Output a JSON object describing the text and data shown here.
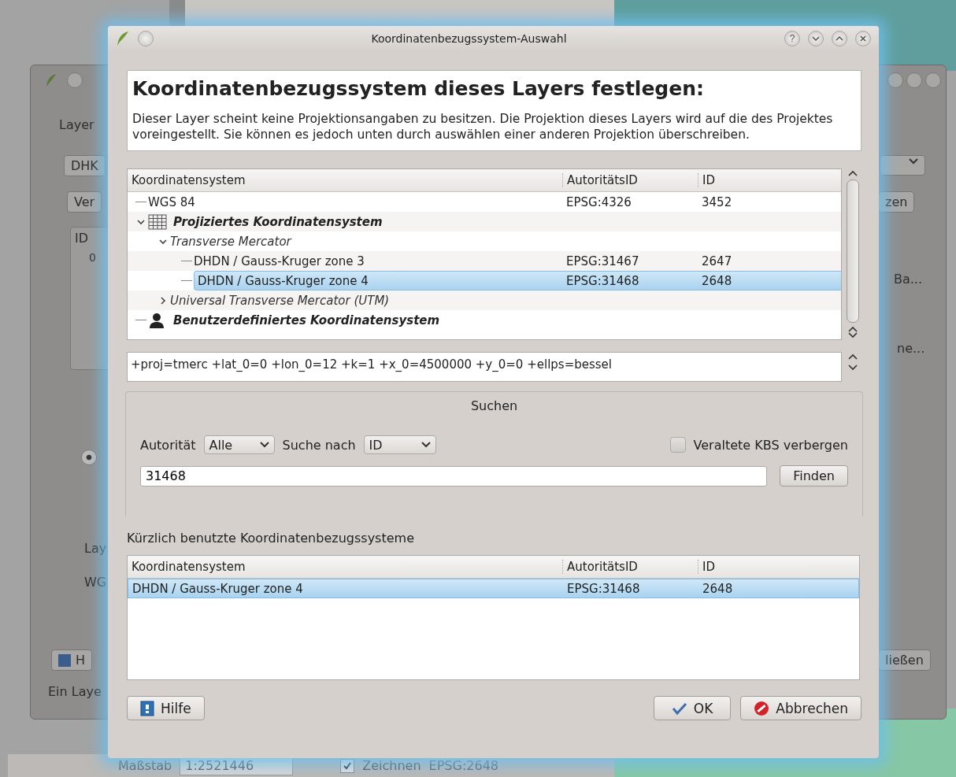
{
  "background_window": {
    "tab": "Layer",
    "combo": "DHK",
    "button": "Ver",
    "list_header": "ID",
    "list_row": "0",
    "radio_checked": true,
    "label_1": "Lay",
    "label_2": "WG",
    "help_button": "H",
    "status": "Ein Laye",
    "right_button": "zen",
    "right_item_1": "Ba...",
    "right_item_2": "ne...",
    "close_button": "ließen"
  },
  "status_bar": {
    "scale_label": "Maßstab",
    "scale": "1:2521446",
    "render_checked": true,
    "render_label": "Zeichnen",
    "crs": "EPSG:2648"
  },
  "dialog": {
    "title": "Koordinatenbezugssystem-Auswahl",
    "help_button": "?",
    "heading": "Koordinatenbezugssystem dieses Layers festlegen:",
    "description": "Dieser Layer scheint keine Projektionsangaben zu besitzen. Die Projektion dieses Layers wird auf die des Projektes voreingestellt. Sie können es jedoch unten durch auswählen einer anderen Projektion überschreiben.",
    "tree": {
      "columns": [
        "Koordinatensystem",
        "AutoritätsID",
        "ID"
      ],
      "rows": [
        {
          "kind": "crs",
          "name": "WGS 84",
          "authority_id": "EPSG:4326",
          "id": "3452",
          "selected": false
        },
        {
          "kind": "projected-category",
          "name": "Projiziertes Koordinatensystem",
          "expanded": true,
          "selected": false,
          "children": [
            {
              "kind": "subcategory",
              "name": "Transverse Mercator",
              "expanded": true,
              "selected": false,
              "children": [
                {
                  "kind": "crs",
                  "name": "DHDN / Gauss-Kruger zone 3",
                  "authority_id": "EPSG:31467",
                  "id": "2647",
                  "selected": false
                },
                {
                  "kind": "crs",
                  "name": "DHDN / Gauss-Kruger zone 4",
                  "authority_id": "EPSG:31468",
                  "id": "2648",
                  "selected": true
                }
              ]
            },
            {
              "kind": "subcategory",
              "name": "Universal Transverse Mercator (UTM)",
              "expanded": false,
              "selected": false
            }
          ]
        },
        {
          "kind": "custom-category",
          "name": "Benutzerdefiniertes Koordinatensystem",
          "selected": false
        }
      ]
    },
    "proj_string": "+proj=tmerc +lat_0=0 +lon_0=12 +k=1 +x_0=4500000 +y_0=0 +ellps=bessel",
    "search": {
      "title": "Suchen",
      "authority_label": "Autorität",
      "authority_value": "Alle",
      "search_by_label": "Suche nach",
      "search_by_value": "ID",
      "hide_deprecated": {
        "label": "Veraltete KBS verbergen",
        "checked": false
      },
      "query": "31468",
      "find_button": "Finden"
    },
    "recent": {
      "label": "Kürzlich benutzte Koordinatenbezugssysteme",
      "columns": [
        "Koordinatensystem",
        "AutoritätsID",
        "ID"
      ],
      "rows": [
        {
          "name": "DHDN / Gauss-Kruger zone 4",
          "authority_id": "EPSG:31468",
          "id": "2648",
          "selected": true
        }
      ]
    },
    "buttons": {
      "help": "Hilfe",
      "ok": "OK",
      "cancel": "Abbrechen"
    }
  }
}
